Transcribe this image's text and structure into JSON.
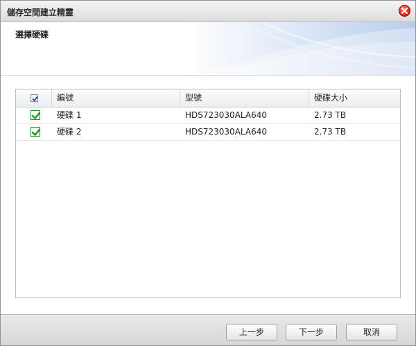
{
  "window": {
    "title": "儲存空間建立精靈",
    "close_icon": "close-icon"
  },
  "step": {
    "title": "選擇硬碟"
  },
  "table": {
    "columns": [
      "編號",
      "型號",
      "硬碟大小"
    ],
    "select_all_checked": true,
    "rows": [
      {
        "checked": true,
        "id": "硬碟 1",
        "model": "HDS723030ALA640",
        "size": "2.73 TB"
      },
      {
        "checked": true,
        "id": "硬碟 2",
        "model": "HDS723030ALA640",
        "size": "2.73 TB"
      }
    ]
  },
  "buttons": {
    "back": "上一步",
    "next": "下一步",
    "cancel": "取消"
  },
  "colors": {
    "accent_blue": "#b9cdea",
    "check_green": "#2f9a2f",
    "close_red": "#e02b1f"
  }
}
